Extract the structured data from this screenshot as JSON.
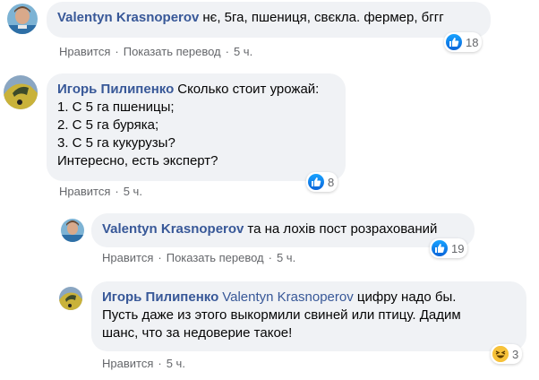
{
  "comments": [
    {
      "author": "Valentyn Krasnoperov",
      "text": "нє, 5га, пшениця, свєкла. фермер, бггг",
      "actions": {
        "like": "Нравится",
        "translate": "Показать перевод",
        "time": "5 ч."
      },
      "reaction": {
        "type": "like",
        "count": "18"
      }
    },
    {
      "author": "Игорь Пилипенко",
      "lines": [
        "Сколько стоит урожай:",
        "1. С 5 га пшеницы;",
        "2. С 5 га буряка;",
        "3. С 5 га кукурузы?",
        "Интересно, есть эксперт?"
      ],
      "actions": {
        "like": "Нравится",
        "time": "5 ч."
      },
      "reaction": {
        "type": "like",
        "count": "8"
      }
    },
    {
      "author": "Valentyn Krasnoperov",
      "text": "та на лохів пост розрахований",
      "actions": {
        "like": "Нравится",
        "translate": "Показать перевод",
        "time": "5 ч."
      },
      "reaction": {
        "type": "like",
        "count": "19"
      }
    },
    {
      "author": "Игорь Пилипенко",
      "mention": "Valentyn Krasnoperov",
      "line1_rest": "цифру надо бы.",
      "line2": "Пусть даже из этого выкормили свиней или птицу. Дадим",
      "line3": "шанс, что за недоверие такое!",
      "actions": {
        "like": "Нравится",
        "time": "5 ч."
      },
      "reaction": {
        "type": "haha",
        "count": "3"
      }
    }
  ],
  "separator": "·",
  "colors": {
    "link": "#385898",
    "bubble": "#f0f2f5",
    "meta": "#65676b",
    "like": "#1877f2",
    "haha": "#f7c23a"
  }
}
